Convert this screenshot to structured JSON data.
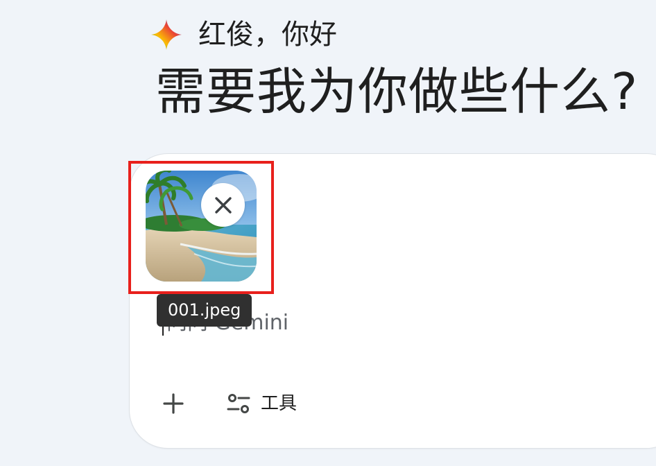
{
  "greeting": {
    "subtitle": "红俊，你好",
    "headline": "需要我为你做些什么?"
  },
  "attachment": {
    "file_name": "001.jpeg",
    "thumbnail_subject": "beach"
  },
  "prompt": {
    "placeholder": "问问 Gemini"
  },
  "toolbar": {
    "add_icon": "plus-icon",
    "tools_icon": "tools-sliders-icon",
    "tools_label": "工具"
  },
  "colors": {
    "page_background": "#f0f4f9",
    "card_background": "#ffffff",
    "highlight_border": "#e8201c",
    "tooltip_background": "#303030",
    "text_primary": "#1f1f1f",
    "placeholder_text": "#5f6368"
  }
}
